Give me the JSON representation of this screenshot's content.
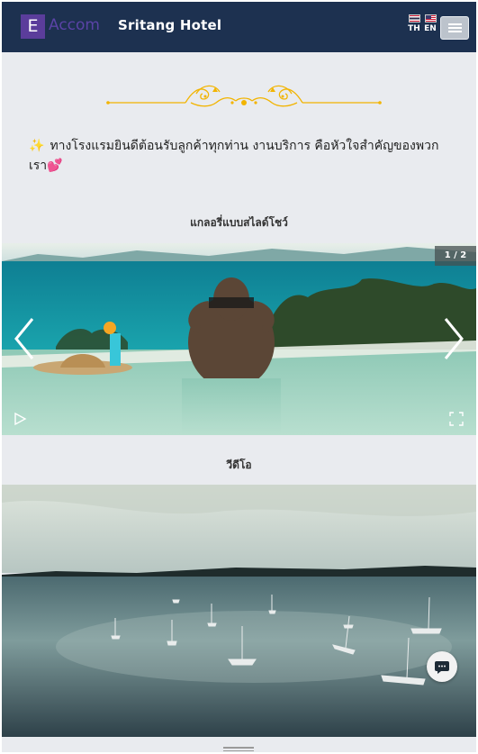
{
  "header": {
    "logo_letter": "E",
    "logo_text": "Accom",
    "hotel_name": "Sritang Hotel",
    "languages": [
      {
        "code": "TH"
      },
      {
        "code": "EN"
      }
    ]
  },
  "welcome": {
    "sparkle": "✨",
    "text": "ทางโรงแรมยินดีต้อนรับลูกค้าทุกท่าน งานบริการ คือหัวใจสำคัญของพวกเรา",
    "heart": "💕"
  },
  "gallery": {
    "title": "แกลอรี่แบบสไลด์โชว์",
    "counter": "1 / 2"
  },
  "video": {
    "title": "วีดีโอ"
  },
  "colors": {
    "header_bg": "#1d3150",
    "page_bg": "#e9ebef",
    "logo_box": "#5b3d9b",
    "ornament_gold": "#f2b400"
  },
  "icons": [
    "menu-icon",
    "chevron-left-icon",
    "chevron-right-icon",
    "play-icon",
    "fullscreen-icon",
    "chat-icon"
  ]
}
